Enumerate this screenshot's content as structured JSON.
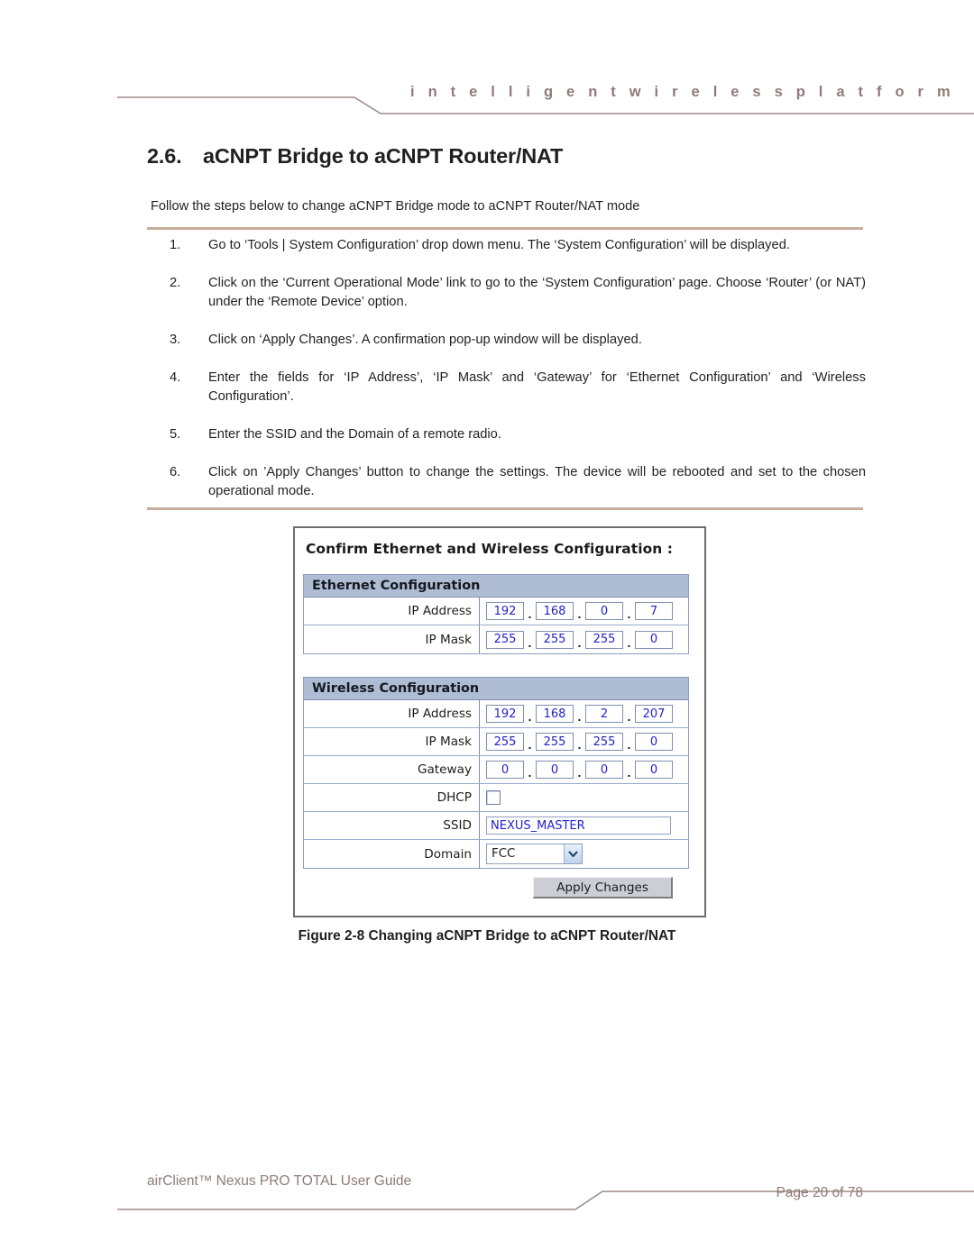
{
  "header": {
    "tagline": "i n t e l l i g e n t     w i r e l e s s     p l a t f o r m",
    "rule_color": "#9b8a86"
  },
  "section": {
    "number": "2.6.",
    "title": "aCNPT Bridge to aCNPT Router/NAT"
  },
  "intro": "Follow the steps below to change aCNPT Bridge mode to aCNPT Router/NAT mode",
  "steps": [
    {
      "num": "1.",
      "text": "Go to ‘Tools | System Configuration’ drop down menu. The ‘System Configuration’ will be displayed."
    },
    {
      "num": "2.",
      "text": "Click on the ‘Current Operational Mode’ link to go to the ‘System Configuration’ page. Choose ‘Router’ (or NAT) under the ‘Remote Device’ option."
    },
    {
      "num": "3.",
      "text": "Click on ‘Apply Changes’. A confirmation pop-up window will be displayed."
    },
    {
      "num": "4.",
      "text": "Enter the fields for ‘IP Address’, ‘IP Mask’ and ‘Gateway’ for ‘Ethernet Configuration’ and ‘Wireless Configuration’."
    },
    {
      "num": "5.",
      "text": "Enter the SSID and the Domain of a remote radio."
    },
    {
      "num": "6.",
      "text": "Click on ’Apply Changes’ button to change the settings. The device will be rebooted and set to the chosen operational mode."
    }
  ],
  "figure": {
    "dialog_title": "Confirm Ethernet and Wireless Configuration :",
    "ethernet": {
      "header": "Ethernet Configuration",
      "rows": [
        {
          "label": "IP Address",
          "type": "ip",
          "octets": [
            "192",
            "168",
            "0",
            "7"
          ]
        },
        {
          "label": "IP Mask",
          "type": "ip",
          "octets": [
            "255",
            "255",
            "255",
            "0"
          ]
        }
      ]
    },
    "wireless": {
      "header": "Wireless Configuration",
      "rows": [
        {
          "label": "IP Address",
          "type": "ip",
          "octets": [
            "192",
            "168",
            "2",
            "207"
          ]
        },
        {
          "label": "IP Mask",
          "type": "ip",
          "octets": [
            "255",
            "255",
            "255",
            "0"
          ]
        },
        {
          "label": "Gateway",
          "type": "ip",
          "octets": [
            "0",
            "0",
            "0",
            "0"
          ]
        },
        {
          "label": "DHCP",
          "type": "checkbox",
          "checked": false
        },
        {
          "label": "SSID",
          "type": "text",
          "value": "NEXUS_MASTER"
        },
        {
          "label": "Domain",
          "type": "select",
          "value": "FCC"
        }
      ]
    },
    "apply_button": "Apply Changes",
    "header_bg": "#aebdd4",
    "input_text_color": "#2222cc",
    "caption": "Figure 2-8 Changing aCNPT Bridge to aCNPT Router/NAT"
  },
  "footer": {
    "left": "airClient™ Nexus PRO TOTAL User Guide",
    "right": "Page 20 of 78",
    "rule_color": "#9b8a86"
  },
  "rules": {
    "color": "#c6ae9a"
  }
}
